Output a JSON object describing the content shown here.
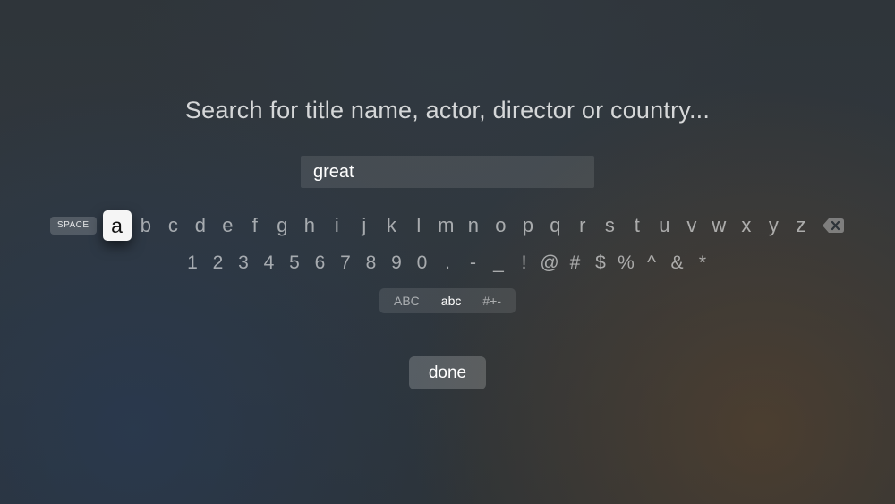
{
  "prompt": "Search for title name, actor, director or country...",
  "search": {
    "value": "great"
  },
  "keyboard": {
    "space_label": "SPACE",
    "letters": [
      "a",
      "b",
      "c",
      "d",
      "e",
      "f",
      "g",
      "h",
      "i",
      "j",
      "k",
      "l",
      "m",
      "n",
      "o",
      "p",
      "q",
      "r",
      "s",
      "t",
      "u",
      "v",
      "w",
      "x",
      "y",
      "z"
    ],
    "digits_symbols": [
      "1",
      "2",
      "3",
      "4",
      "5",
      "6",
      "7",
      "8",
      "9",
      "0",
      ".",
      "-",
      "_",
      "!",
      "@",
      "#",
      "$",
      "%",
      "^",
      "&",
      "*"
    ],
    "focused_letter_index": 0,
    "modes": {
      "upper": "ABC",
      "lower": "abc",
      "symbols": "#+-"
    },
    "done_label": "done"
  }
}
